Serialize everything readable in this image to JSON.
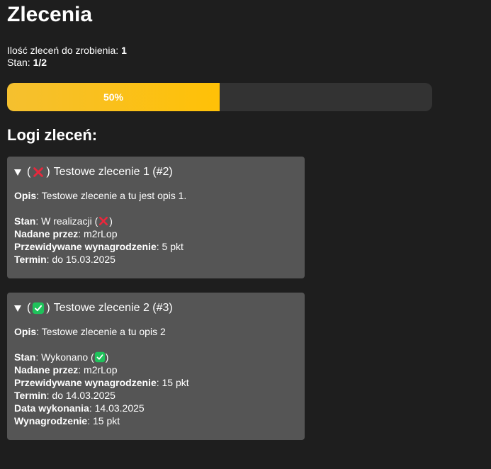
{
  "page": {
    "title": "Zlecenia"
  },
  "summary": {
    "todo_label": "Ilość zleceń do zrobienia:",
    "todo_value": "1",
    "state_label": "Stan:",
    "state_value": "1/2"
  },
  "progress": {
    "value": 0.5,
    "label": "50%",
    "fill_color": "#ffc107",
    "track_color": "#333333"
  },
  "logs": {
    "title": "Logi zleceń:",
    "items": [
      {
        "status_icon": "red-cross-icon",
        "open_paren": "(",
        "close_paren": ")",
        "title": "Testowe zlecenie 1 (#2)",
        "description_label": "Opis",
        "description": ": Testowe zlecenie a tu jest opis 1.",
        "state_label": "Stan",
        "state_value": ": W realizacji (",
        "state_close": ")",
        "given_by_label": "Nadane przez",
        "given_by_value": ": m2rLop",
        "reward_expected_label": "Przewidywane wynagrodzenie",
        "reward_expected_value": ": 5 pkt",
        "deadline_label": "Termin",
        "deadline_value": ": do 15.03.2025"
      },
      {
        "status_icon": "green-check-icon",
        "open_paren": "(",
        "close_paren": ")",
        "title": "Testowe zlecenie 2 (#3)",
        "description_label": "Opis",
        "description": ": Testowe zlecenie a tu opis 2",
        "state_label": "Stan",
        "state_value": ": Wykonano (",
        "state_close": ")",
        "given_by_label": "Nadane przez",
        "given_by_value": ": m2rLop",
        "reward_expected_label": "Przewidywane wynagrodzenie",
        "reward_expected_value": ": 15 pkt",
        "deadline_label": "Termin",
        "deadline_value": ": do 14.03.2025",
        "completed_label": "Data wykonania",
        "completed_value": ": 14.03.2025",
        "reward_label": "Wynagrodzenie",
        "reward_value": ": 15 pkt"
      }
    ]
  },
  "colors": {
    "background": "#1e1e1e",
    "card": "#555555",
    "cross": "#e8283c",
    "check": "#1fc25b"
  }
}
